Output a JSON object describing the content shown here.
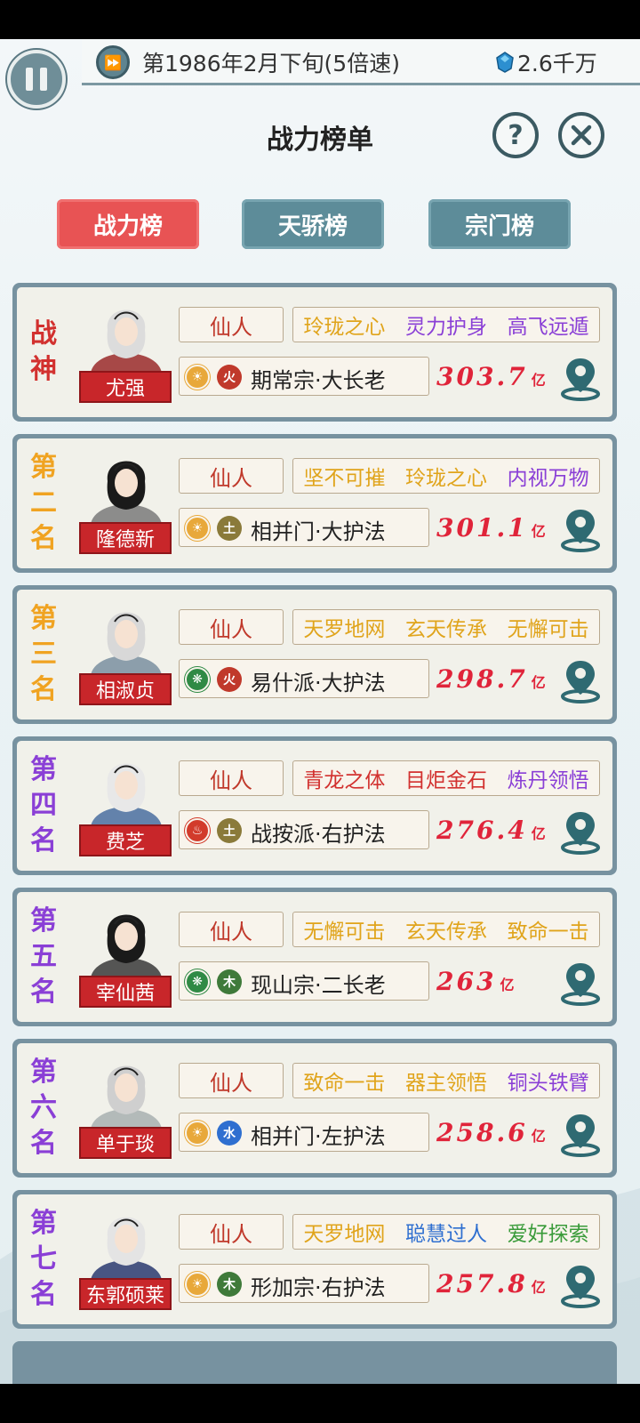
{
  "header": {
    "date": "第1986年2月下旬(5倍速)",
    "money": "2.6千万",
    "title": "战力榜单",
    "help_label": "?"
  },
  "tabs": [
    {
      "label": "战力榜",
      "active": true
    },
    {
      "label": "天骄榜",
      "active": false
    },
    {
      "label": "宗门榜",
      "active": false
    }
  ],
  "colors": {
    "active_tab": "#e85354",
    "inactive_tab": "#5d8c99",
    "card_border": "#7792a0",
    "power": "#e0243a",
    "name_plate": "#c8262a"
  },
  "rows": [
    {
      "rank": [
        "战",
        "神"
      ],
      "rank_color": "#d2312f",
      "name": "尤强",
      "realm": "仙人",
      "traits": [
        {
          "text": "玲珑之心",
          "color": "#e0a41b"
        },
        {
          "text": "灵力护身",
          "color": "#8a3fd6"
        },
        {
          "text": "高飞远遁",
          "color": "#8a3fd6"
        }
      ],
      "badge1": "sun",
      "badge2": "火",
      "badge2_color": "#c0392b",
      "sect": "期常宗·大长老",
      "power": "303.7",
      "power_unit": "亿"
    },
    {
      "rank": [
        "第",
        "二",
        "名"
      ],
      "rank_color": "#f0a321",
      "name": "隆德新",
      "realm": "仙人",
      "traits": [
        {
          "text": "坚不可摧",
          "color": "#e0a41b"
        },
        {
          "text": "玲珑之心",
          "color": "#e0a41b"
        },
        {
          "text": "内视万物",
          "color": "#8a3fd6"
        }
      ],
      "badge1": "sun",
      "badge2": "土",
      "badge2_color": "#8a7a3a",
      "sect": "相并门·大护法",
      "power": "301.1",
      "power_unit": "亿"
    },
    {
      "rank": [
        "第",
        "三",
        "名"
      ],
      "rank_color": "#f0a321",
      "name": "相淑贞",
      "realm": "仙人",
      "traits": [
        {
          "text": "天罗地网",
          "color": "#e0a41b"
        },
        {
          "text": "玄天传承",
          "color": "#e0a41b"
        },
        {
          "text": "无懈可击",
          "color": "#e0a41b"
        }
      ],
      "badge1": "leaf",
      "badge2": "火",
      "badge2_color": "#c0392b",
      "sect": "易什派·大护法",
      "power": "298.7",
      "power_unit": "亿"
    },
    {
      "rank": [
        "第",
        "四",
        "名"
      ],
      "rank_color": "#8a3fd6",
      "name": "费芝",
      "realm": "仙人",
      "traits": [
        {
          "text": "青龙之体",
          "color": "#d2312f"
        },
        {
          "text": "目炬金石",
          "color": "#d2312f"
        },
        {
          "text": "炼丹领悟",
          "color": "#8a3fd6"
        }
      ],
      "badge1": "fire",
      "badge2": "土",
      "badge2_color": "#8a7a3a",
      "sect": "战按派·右护法",
      "power": "276.4",
      "power_unit": "亿"
    },
    {
      "rank": [
        "第",
        "五",
        "名"
      ],
      "rank_color": "#8a3fd6",
      "name": "宰仙茜",
      "realm": "仙人",
      "traits": [
        {
          "text": "无懈可击",
          "color": "#e0a41b"
        },
        {
          "text": "玄天传承",
          "color": "#e0a41b"
        },
        {
          "text": "致命一击",
          "color": "#e0a41b"
        }
      ],
      "badge1": "leaf",
      "badge2": "木",
      "badge2_color": "#3f7a3a",
      "sect": "现山宗·二长老",
      "power": "263",
      "power_unit": "亿"
    },
    {
      "rank": [
        "第",
        "六",
        "名"
      ],
      "rank_color": "#8a3fd6",
      "name": "单于琰",
      "realm": "仙人",
      "traits": [
        {
          "text": "致命一击",
          "color": "#e0a41b"
        },
        {
          "text": "器主领悟",
          "color": "#e0a41b"
        },
        {
          "text": "铜头铁臂",
          "color": "#8a3fd6"
        }
      ],
      "badge1": "sun",
      "badge2": "水",
      "badge2_color": "#2f6fd0",
      "sect": "相并门·左护法",
      "power": "258.6",
      "power_unit": "亿"
    },
    {
      "rank": [
        "第",
        "七",
        "名"
      ],
      "rank_color": "#8a3fd6",
      "name": "东郭硕莱",
      "realm": "仙人",
      "traits": [
        {
          "text": "天罗地网",
          "color": "#e0a41b"
        },
        {
          "text": "聪慧过人",
          "color": "#2f6fd0"
        },
        {
          "text": "爱好探索",
          "color": "#3a9b3a"
        }
      ],
      "badge1": "sun",
      "badge2": "木",
      "badge2_color": "#3f7a3a",
      "sect": "形加宗·右护法",
      "power": "257.8",
      "power_unit": "亿"
    }
  ]
}
